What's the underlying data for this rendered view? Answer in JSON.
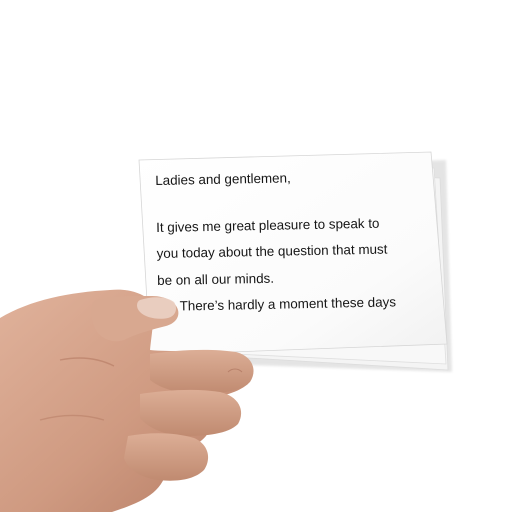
{
  "card": {
    "greeting": "Ladies and gentlemen,",
    "lines": [
      "It gives me great pleasure to speak to",
      "you today about the question that must",
      "be on all our minds.",
      "There’s hardly a moment these days"
    ]
  },
  "colors": {
    "background": "#ffffff",
    "paper": "#ffffff",
    "text": "#161616",
    "skin": "#d29f86"
  }
}
